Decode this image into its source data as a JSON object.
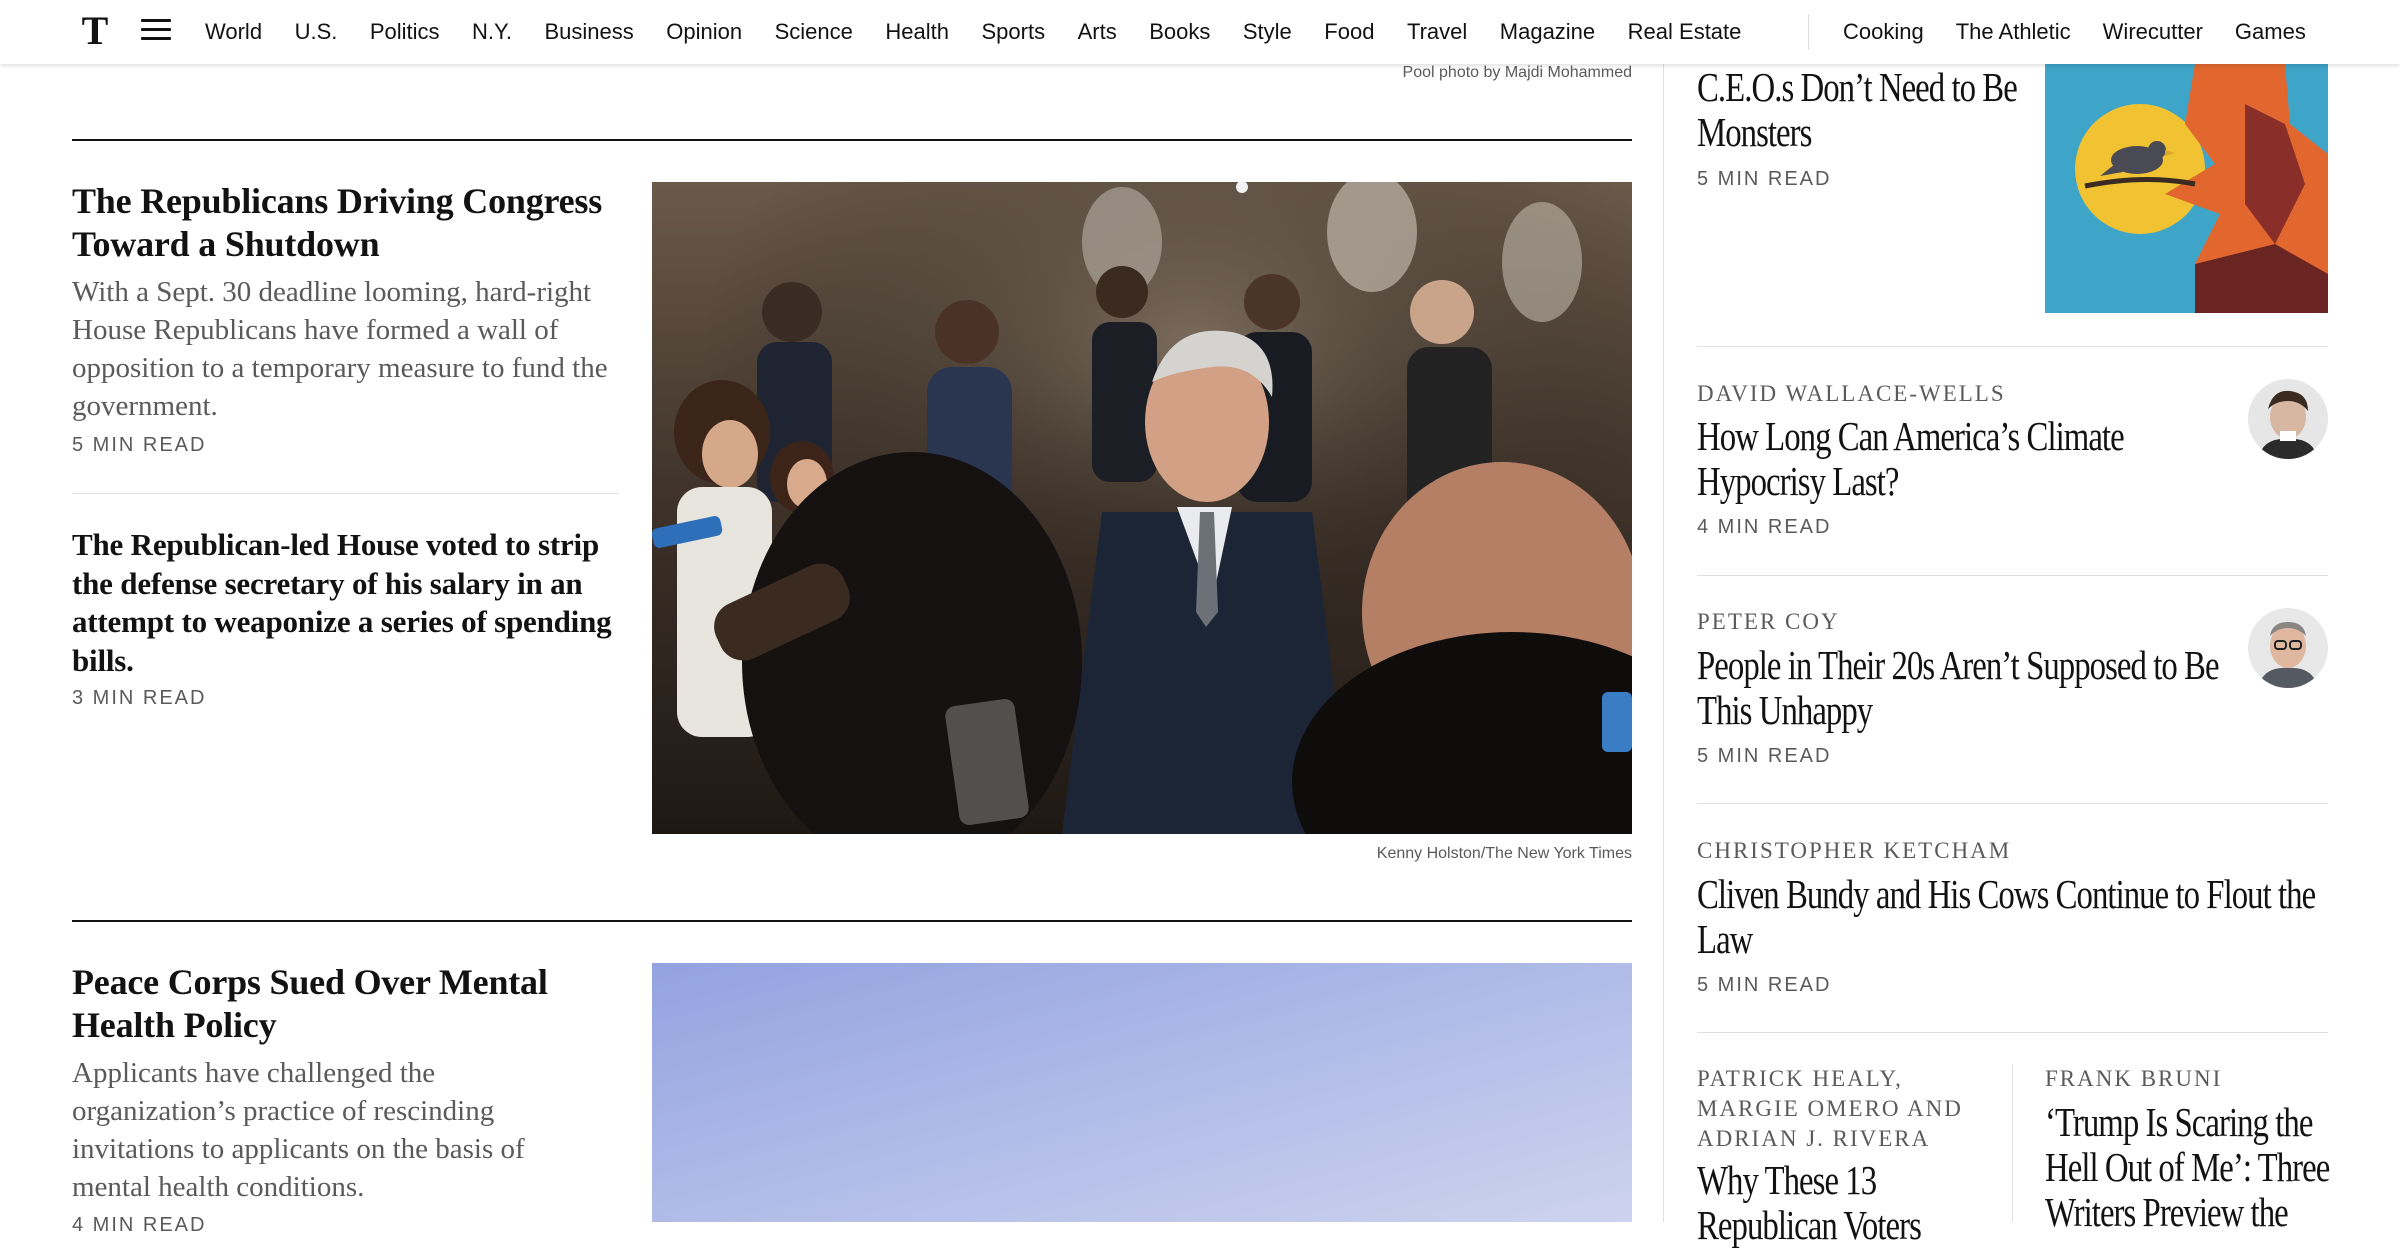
{
  "nav": {
    "logo_letter": "T",
    "sections": [
      "World",
      "U.S.",
      "Politics",
      "N.Y.",
      "Business",
      "Opinion",
      "Science",
      "Health",
      "Sports",
      "Arts",
      "Books",
      "Style",
      "Food",
      "Travel",
      "Magazine",
      "Real Estate"
    ],
    "products": [
      "Cooking",
      "The Athletic",
      "Wirecutter",
      "Games"
    ]
  },
  "main": {
    "top_caption": "Pool photo by Majdi Mohammed",
    "story1": {
      "headline": "The Republicans Driving Congress Toward a Shutdown",
      "summary": "With a Sept. 30 deadline looming, hard-right House Republicans have formed a wall of opposition to a temporary measure to fund the government.",
      "read_time": "5 MIN READ"
    },
    "story2": {
      "headline": "The Republican-led House voted to strip the defense secretary of his salary in an attempt to weaponize a series of spending bills.",
      "read_time": "3 MIN READ"
    },
    "photo1_caption": "Kenny Holston/The New York Times",
    "story3": {
      "headline": "Peace Corps Sued Over Mental Health Policy",
      "summary": "Applicants have challenged the organization’s practice of rescinding invitations to applicants on the basis of mental health conditions.",
      "read_time": "4 MIN READ"
    }
  },
  "opinion": {
    "top": {
      "headline": "C.E.O.s Don’t Need to Be Monsters",
      "read_time": "5 MIN READ"
    },
    "items": [
      {
        "author": "DAVID WALLACE-WELLS",
        "headline": "How Long Can America’s Climate Hypocrisy Last?",
        "read_time": "4 MIN READ"
      },
      {
        "author": "PETER COY",
        "headline": "People in Their 20s Aren’t Supposed to Be This Unhappy",
        "read_time": "5 MIN READ"
      },
      {
        "author": "CHRISTOPHER KETCHAM",
        "headline": "Cliven Bundy and His Cows Continue to Flout the Law",
        "read_time": "5 MIN READ"
      }
    ],
    "bottom_left": {
      "author": "PATRICK HEALY, MARGIE OMERO AND ADRIAN J. RIVERA",
      "headline": "Why These 13 Republican Voters"
    },
    "bottom_right": {
      "author": "FRANK BRUNI",
      "headline": "‘Trump Is Scaring the Hell Out of Me’: Three Writers Preview the"
    }
  }
}
